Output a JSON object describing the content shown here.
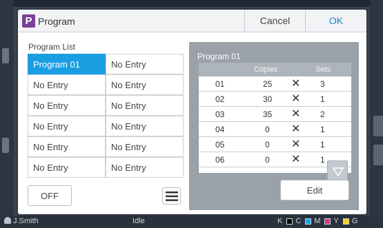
{
  "dialog": {
    "app_badge": "P",
    "title": "Program",
    "cancel_label": "Cancel",
    "ok_label": "OK"
  },
  "program_list": {
    "label": "Program List",
    "selected_index": 0,
    "items": [
      "Program 01",
      "No Entry",
      "No Entry",
      "No Entry",
      "No Entry",
      "No Entry",
      "No Entry",
      "No Entry",
      "No Entry",
      "No Entry",
      "No Entry",
      "No Entry"
    ],
    "off_label": "OFF"
  },
  "detail": {
    "title": "Program 01",
    "columns": {
      "copies": "Copies",
      "sets": "Sets"
    },
    "rows": [
      {
        "no": "01",
        "copies": "25",
        "sets": "3"
      },
      {
        "no": "02",
        "copies": "30",
        "sets": "1"
      },
      {
        "no": "03",
        "copies": "35",
        "sets": "2"
      },
      {
        "no": "04",
        "copies": "0",
        "sets": "1"
      },
      {
        "no": "05",
        "copies": "0",
        "sets": "1"
      },
      {
        "no": "06",
        "copies": "0",
        "sets": "1"
      }
    ],
    "multiply_symbol": "✕",
    "edit_label": "Edit"
  },
  "statusbar": {
    "user": "J.Smith",
    "state": "Idle",
    "ink": [
      "K",
      "C",
      "M",
      "Y",
      "G"
    ]
  },
  "colors": {
    "accent": "#1a9ee2",
    "ok_text": "#1a84c8",
    "app_badge": "#7b3f98",
    "panel": "#9aa1a9"
  }
}
